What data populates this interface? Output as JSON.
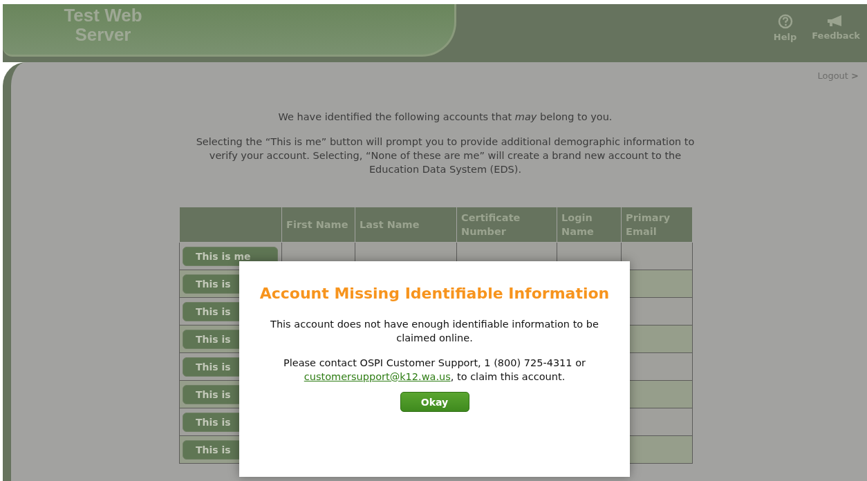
{
  "header": {
    "site_title": "Test Web Server",
    "actions": [
      {
        "kind": "help",
        "label": "Help"
      },
      {
        "kind": "feedback",
        "label": "Feedback"
      }
    ]
  },
  "logout": {
    "label": "Logout",
    "arrow": ">"
  },
  "intro": [
    "We have identified the following accounts that *may* belong to you.",
    "Selecting the “This is me” button will prompt you to provide additional demographic information to verify your account. Selecting, “None of these are me” will create a brand new account to the Education Data System (EDS)."
  ],
  "table": {
    "columns": [
      "",
      "First Name",
      "Last Name",
      "Certificate Number",
      "Login Name",
      "Primary Email"
    ],
    "rows": [
      {
        "button": "This is me",
        "cells": [
          "",
          "",
          "",
          "",
          ""
        ]
      },
      {
        "button": "This is",
        "cells": [
          "",
          "",
          "",
          "",
          ""
        ]
      },
      {
        "button": "This is",
        "cells": [
          "",
          "",
          "",
          "",
          ""
        ]
      },
      {
        "button": "This is",
        "cells": [
          "",
          "",
          "",
          "",
          ""
        ]
      },
      {
        "button": "This is",
        "cells": [
          "",
          "",
          "",
          "",
          ""
        ]
      },
      {
        "button": "This is",
        "cells": [
          "",
          "",
          "",
          "",
          ""
        ]
      },
      {
        "button": "This is",
        "cells": [
          "",
          "",
          "",
          "",
          ""
        ]
      },
      {
        "button": "This is",
        "cells": [
          "",
          "",
          "",
          "",
          ""
        ]
      }
    ]
  },
  "modal": {
    "title": "Account Missing Identifiable Information",
    "message": "This account does not have enough identifiable information to be claimed online.",
    "contact_text": "Please contact OSPI Customer Support, 1 (800) 725-4311 or",
    "contact_link": "customersupport@k12.wa.us",
    "contact_suffix": ", to claim this account.",
    "button": "Okay"
  }
}
